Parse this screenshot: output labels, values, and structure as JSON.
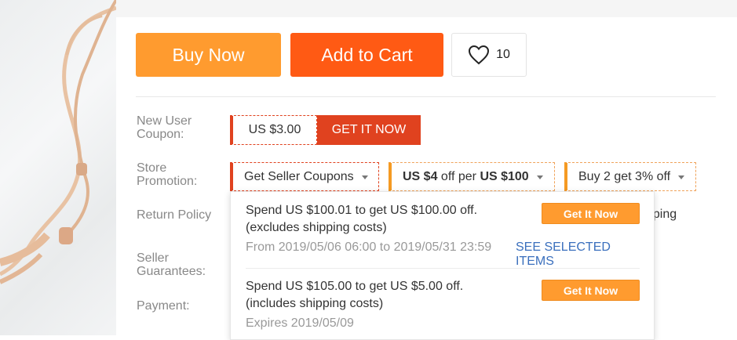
{
  "actions": {
    "buy_now": "Buy Now",
    "add_to_cart": "Add to Cart",
    "wishlist_count": "10"
  },
  "new_user_coupon": {
    "label": "New User Coupon:",
    "value": "US $3.00",
    "get_label": "GET IT NOW"
  },
  "store_promotion": {
    "label": "Store Promotion:",
    "options": [
      {
        "text": "Get Seller Coupons"
      },
      {
        "pre": "",
        "b1": "US $4",
        "mid": " off per ",
        "b2": "US $100"
      },
      {
        "text": "Buy 2 get 3% off"
      }
    ]
  },
  "return_policy": {
    "label": "Return Policy",
    "partial_text": "pping"
  },
  "seller_guarantees": {
    "label": "Seller Guarantees:"
  },
  "payment": {
    "label": "Payment:"
  },
  "coupons_panel": {
    "offers": [
      {
        "line1": "Spend US $100.01 to get US $100.00 off.",
        "line2": "(excludes shipping costs)",
        "meta": "From 2019/05/06 06:00 to 2019/05/31 23:59",
        "link": "SEE SELECTED ITEMS",
        "button": "Get It Now"
      },
      {
        "line1": "Spend US $105.00 to get US $5.00 off.",
        "line2": "(includes shipping costs)",
        "meta": "Expires 2019/05/09",
        "button": "Get It Now"
      }
    ]
  },
  "colors": {
    "buy_now": "#ff9b2f",
    "add_to_cart": "#ff5a14",
    "coupon_red": "#e0421f",
    "link_blue": "#3a6fbd"
  }
}
